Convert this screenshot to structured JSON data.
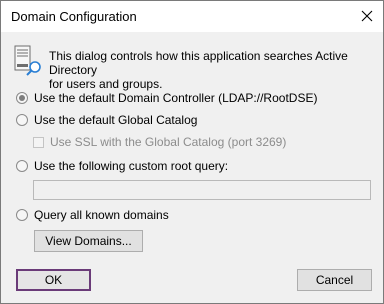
{
  "window": {
    "title": "Domain Configuration"
  },
  "info": {
    "icon": "server-search-icon",
    "text_line1": "This dialog controls how this application searches Active Directory",
    "text_line2": "for users and groups."
  },
  "options": {
    "default_dc": {
      "label": "Use the default Domain Controller (LDAP://RootDSE)",
      "selected": true
    },
    "global_catalog": {
      "label": "Use the default Global Catalog",
      "selected": false
    },
    "use_ssl": {
      "label": "Use SSL with the Global Catalog (port 3269)",
      "checked": false,
      "enabled": false
    },
    "custom_query": {
      "label": "Use the following custom root query:",
      "selected": false,
      "value": ""
    },
    "all_domains": {
      "label": "Query all known domains",
      "selected": false
    }
  },
  "buttons": {
    "view_domains": "View Domains...",
    "ok": "OK",
    "cancel": "Cancel"
  }
}
